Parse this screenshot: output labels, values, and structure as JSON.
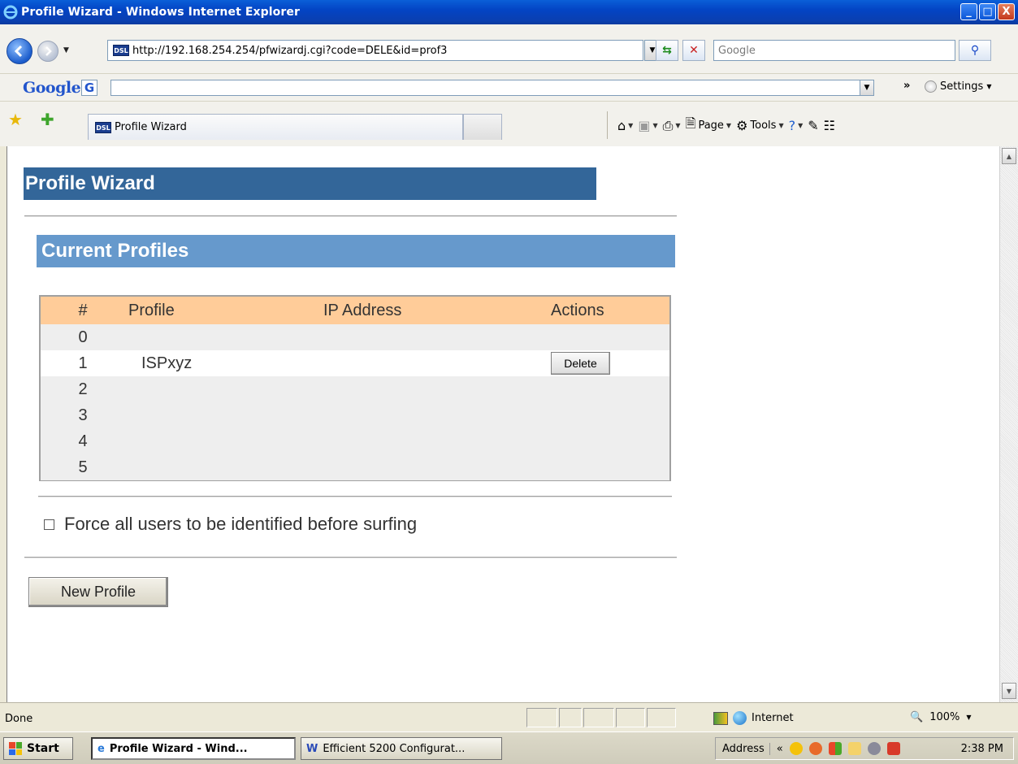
{
  "window": {
    "title": "Profile Wizard - Windows Internet Explorer",
    "min_label": "_",
    "max_label": "□",
    "close_label": "X"
  },
  "nav": {
    "url": "http://192.168.254.254/pfwizardj.cgi?code=DELE&id=prof3",
    "search_placeholder": "Google"
  },
  "google_toolbar": {
    "logo": "Google",
    "g_button": "G",
    "more": "»",
    "settings_label": "Settings"
  },
  "tabs": [
    {
      "label": "Profile Wizard"
    }
  ],
  "commands": {
    "page_label": "Page",
    "tools_label": "Tools"
  },
  "page": {
    "title": "Profile Wizard",
    "section_title": "Current Profiles",
    "columns": [
      "#",
      "Profile",
      "IP Address",
      "Actions"
    ],
    "rows": [
      {
        "num": "0",
        "profile": "",
        "ip": "",
        "action": ""
      },
      {
        "num": "1",
        "profile": "ISPxyz",
        "ip": "",
        "action": "Delete"
      },
      {
        "num": "2",
        "profile": "",
        "ip": "",
        "action": ""
      },
      {
        "num": "3",
        "profile": "",
        "ip": "",
        "action": ""
      },
      {
        "num": "4",
        "profile": "",
        "ip": "",
        "action": ""
      },
      {
        "num": "5",
        "profile": "",
        "ip": "",
        "action": ""
      }
    ],
    "force_label": "Force all users to be identified before surfing",
    "force_checked": false,
    "new_profile_label": "New Profile"
  },
  "status": {
    "text": "Done",
    "zone": "Internet",
    "zoom": "100%"
  },
  "taskbar": {
    "start_label": "Start",
    "tasks": [
      {
        "label": "Profile Wizard - Wind...",
        "active": true
      },
      {
        "label": "Efficient 5200 Configurat...",
        "active": false
      }
    ],
    "tray_address_label": "Address",
    "clock": "2:38 PM"
  },
  "colors": {
    "title_header": "#336699",
    "section_header": "#6699cc",
    "table_header": "#ffcc99"
  }
}
